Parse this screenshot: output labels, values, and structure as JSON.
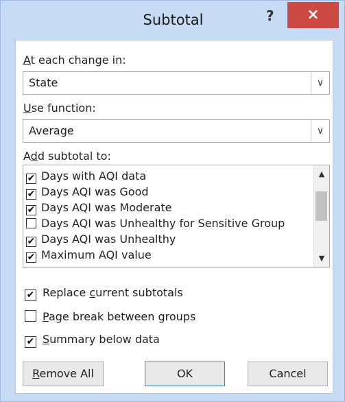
{
  "dialog": {
    "title": "Subtotal",
    "help_icon": "?",
    "close_icon": "×"
  },
  "change_in": {
    "label_key": "A",
    "label_rest": "t each change in:",
    "value": "State"
  },
  "function": {
    "label_key": "U",
    "label_rest": "se function:",
    "value": "Average"
  },
  "add_to": {
    "label_pre": "A",
    "label_key": "d",
    "label_rest": "d subtotal to:",
    "items": [
      {
        "label": "Days with AQI data",
        "checked": true,
        "mark": "✔"
      },
      {
        "label": "Days AQI was Good",
        "checked": true,
        "mark": "✔"
      },
      {
        "label": "Days AQI was Moderate",
        "checked": true,
        "mark": "✔"
      },
      {
        "label": "Days AQI was Unhealthy for Sensitive Group",
        "checked": false,
        "mark": ""
      },
      {
        "label": "Days AQI was Unhealthy",
        "checked": true,
        "mark": "✔"
      },
      {
        "label": "Maximum AQI value",
        "checked": true,
        "mark": "✔"
      }
    ]
  },
  "options": {
    "replace": {
      "pre": "Replace ",
      "key": "c",
      "rest": "urrent subtotals",
      "checked": true,
      "mark": "✔"
    },
    "page_break": {
      "pre": "",
      "key": "P",
      "rest": "age break between groups",
      "checked": false,
      "mark": ""
    },
    "summary": {
      "pre": "",
      "key": "S",
      "rest": "ummary below data",
      "checked": true,
      "mark": "✔"
    }
  },
  "buttons": {
    "remove_all_key": "R",
    "remove_all_rest": "emove All",
    "ok": "OK",
    "cancel": "Cancel"
  }
}
